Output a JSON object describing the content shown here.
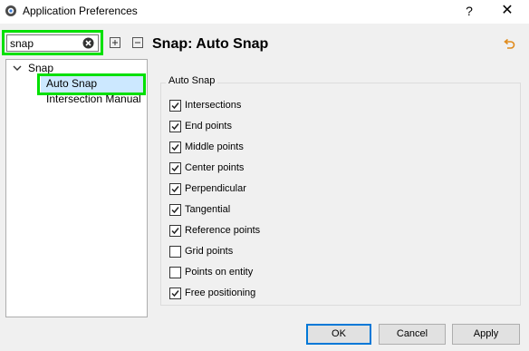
{
  "window": {
    "title": "Application Preferences",
    "help_label": "?",
    "close_label": "✕"
  },
  "search": {
    "value": "snap"
  },
  "tree": {
    "root_label": "Snap",
    "items": [
      {
        "label": "Auto Snap",
        "selected": true
      },
      {
        "label": "Intersection Manual",
        "selected": false
      }
    ]
  },
  "page": {
    "title": "Snap: Auto Snap"
  },
  "auto_snap": {
    "group_title": "Auto Snap",
    "options": [
      {
        "label": "Intersections",
        "checked": true
      },
      {
        "label": "End points",
        "checked": true
      },
      {
        "label": "Middle points",
        "checked": true
      },
      {
        "label": "Center points",
        "checked": true
      },
      {
        "label": "Perpendicular",
        "checked": true
      },
      {
        "label": "Tangential",
        "checked": true
      },
      {
        "label": "Reference points",
        "checked": true
      },
      {
        "label": "Grid points",
        "checked": false
      },
      {
        "label": "Points on entity",
        "checked": false
      },
      {
        "label": "Free positioning",
        "checked": true
      }
    ]
  },
  "buttons": {
    "ok": "OK",
    "cancel": "Cancel",
    "apply": "Apply"
  },
  "colors": {
    "highlight": "#00e000",
    "selection": "#cce8ff",
    "default_button_border": "#0078d7"
  }
}
